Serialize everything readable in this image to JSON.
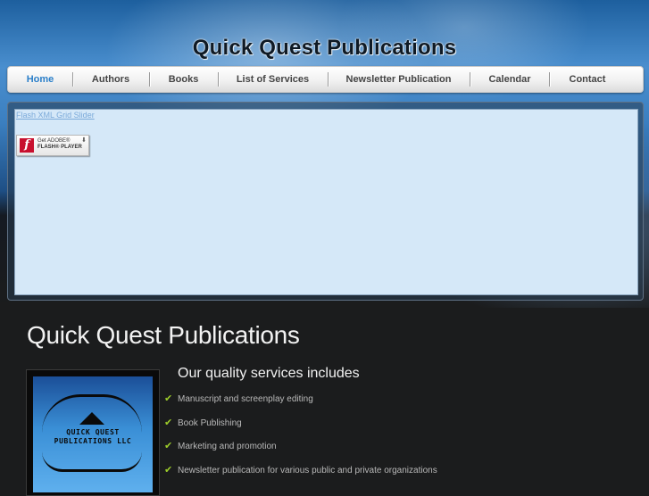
{
  "site": {
    "title": "Quick Quest Publications"
  },
  "nav": {
    "items": [
      {
        "label": "Home",
        "active": true
      },
      {
        "label": "Authors"
      },
      {
        "label": "Books"
      },
      {
        "label": "List of Services"
      },
      {
        "label": "Newsletter Publication"
      },
      {
        "label": "Calendar"
      },
      {
        "label": "Contact"
      }
    ]
  },
  "slider": {
    "link_text": "Flash XML Grid Slider",
    "flash_badge": {
      "line1": "Get ADOBE®",
      "line2": "FLASH® PLAYER",
      "logo_letter": "f"
    }
  },
  "main": {
    "heading": "Quick Quest Publications",
    "logo": {
      "line1": "QUICK QUEST",
      "line2": "PUBLICATIONS LLC"
    },
    "services_heading": "Our quality services includes",
    "services": [
      "Manuscript and screenplay editing",
      "Book Publishing",
      "Marketing and promotion",
      "Newsletter publication for various public and private organizations"
    ]
  },
  "colors": {
    "accent": "#2b7fc9",
    "check": "#9ccc2a",
    "background": "#1b1c1d"
  }
}
